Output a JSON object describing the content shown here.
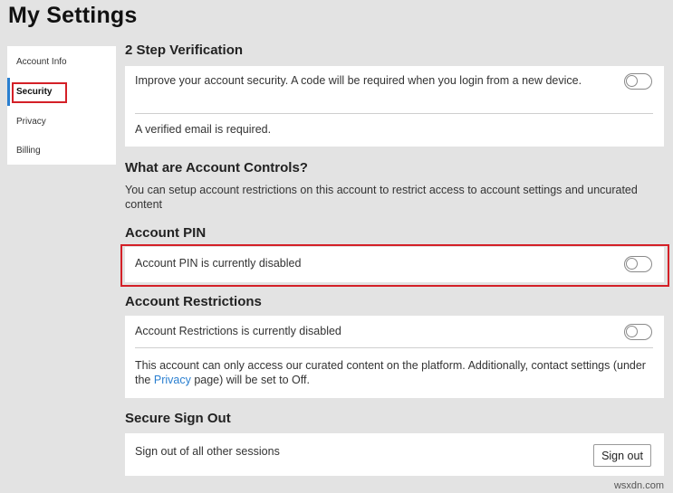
{
  "page": {
    "title": "My Settings"
  },
  "sidebar": {
    "items": [
      {
        "label": "Account Info",
        "active": false
      },
      {
        "label": "Security",
        "active": true
      },
      {
        "label": "Privacy",
        "active": false
      },
      {
        "label": "Billing",
        "active": false
      }
    ]
  },
  "two_step": {
    "title": "2 Step Verification",
    "description": "Improve your account security. A code will be required when you login from a new device.",
    "toggle_on": false,
    "note": "A verified email is required."
  },
  "account_controls": {
    "title": "What are Account Controls?",
    "description": "You can setup account restrictions on this account to restrict access to account settings and uncurated content"
  },
  "account_pin": {
    "title": "Account PIN",
    "status": "Account PIN is currently disabled",
    "toggle_on": false
  },
  "account_restrictions": {
    "title": "Account Restrictions",
    "status": "Account Restrictions is currently disabled",
    "toggle_on": false,
    "info_part1": "This account can only access our curated content on the platform. Additionally, contact settings (under the ",
    "info_link": "Privacy",
    "info_part2": " page) will be set to Off."
  },
  "secure_sign_out": {
    "title": "Secure Sign Out",
    "description": "Sign out of all other sessions",
    "button_label": "Sign out"
  },
  "watermark": "wsxdn.com",
  "colors": {
    "accent": "#2a7fd0",
    "highlight": "#d42027",
    "background": "#e3e3e3"
  }
}
